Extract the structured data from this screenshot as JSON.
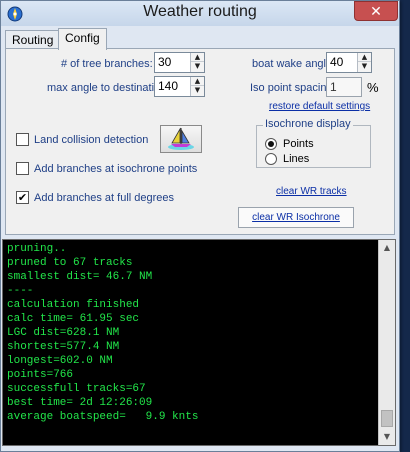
{
  "window": {
    "title": "Weather routing",
    "close_glyph": "✕"
  },
  "tabs": [
    {
      "label": "Routing",
      "active": false
    },
    {
      "label": "Config",
      "active": true
    }
  ],
  "config": {
    "tree_branches_label": "# of tree branches:",
    "tree_branches_value": "30",
    "max_angle_label": "max angle to destination:",
    "max_angle_value": "140",
    "boat_wake_label": "boat wake angle:",
    "boat_wake_value": "40",
    "iso_spacing_label": "Iso point spacing:",
    "iso_spacing_value": "1",
    "iso_spacing_unit": "%",
    "restore_defaults": "restore default settings",
    "land_collision_label": "Land collision detection",
    "land_collision_checked": false,
    "branches_iso_label": "Add branches at isochrone points",
    "branches_iso_checked": false,
    "branches_full_label": "Add branches at full degrees",
    "branches_full_checked": true,
    "check_glyph": "✔",
    "isochrone_display_title": "Isochrone display",
    "radio_points": "Points",
    "radio_lines": "Lines",
    "selected_display": "Points",
    "clear_wr_tracks": "clear WR tracks",
    "clear_wr_isochrone": "clear WR  Isochrone"
  },
  "console": {
    "lines": [
      "pruning..",
      "pruned to 67 tracks",
      "smallest dist= 46.7 NM",
      "----",
      "calculation finished",
      "calc time= 61.95 sec",
      "LGC dist=628.1 NM",
      "shortest=577.4 NM",
      "longest=602.0 NM",
      "points=766",
      "successfull tracks=67",
      "best time= 2d 12:26:09",
      "average boatspeed=   9.9 knts"
    ]
  },
  "colors": {
    "console_text": "#22e64a",
    "console_bg": "#000000",
    "label_blue": "#1f3f86",
    "link_blue": "#0b2fa6",
    "close_red": "#c75050"
  },
  "icons": {
    "app": "compass-icon",
    "boat_button": "sailboat-icon",
    "scroll_up": "chevron-up-icon",
    "scroll_down": "chevron-down-icon"
  }
}
